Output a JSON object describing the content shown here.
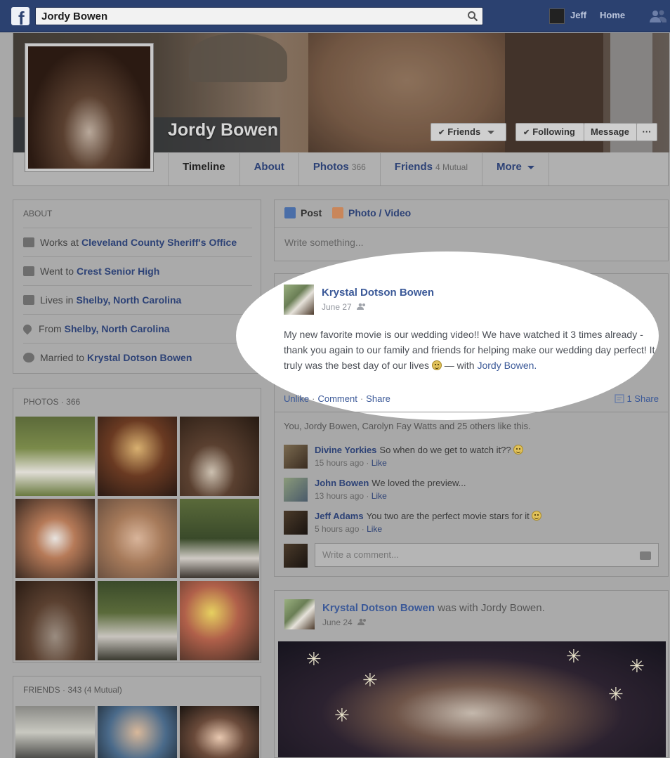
{
  "topbar": {
    "search_value": "Jordy Bowen",
    "user_name": "Jeff",
    "home_label": "Home"
  },
  "profile": {
    "name": "Jordy Bowen",
    "buttons": {
      "friends": "Friends",
      "following": "Following",
      "message": "Message",
      "more": "···"
    },
    "tabs": [
      {
        "label": "Timeline",
        "count": ""
      },
      {
        "label": "About",
        "count": ""
      },
      {
        "label": "Photos",
        "count": "366"
      },
      {
        "label": "Friends",
        "count": "4 Mutual"
      },
      {
        "label": "More",
        "count": ""
      }
    ]
  },
  "about": {
    "title": "ABOUT",
    "items": [
      {
        "prefix": "Works at",
        "link": "Cleveland County Sheriff's Office",
        "icon": "briefcase-icon"
      },
      {
        "prefix": "Went to",
        "link": "Crest Senior High",
        "icon": "school-icon"
      },
      {
        "prefix": "Lives in",
        "link": "Shelby, North Carolina",
        "icon": "home-icon"
      },
      {
        "prefix": "From",
        "link": "Shelby, North Carolina",
        "icon": "location-pin-icon"
      },
      {
        "prefix": "Married to",
        "link": "Krystal Dotson Bowen",
        "icon": "heart-icon"
      }
    ]
  },
  "photos_panel": {
    "title": "PHOTOS",
    "count": "366"
  },
  "friends_panel": {
    "title": "FRIENDS",
    "count": "343 (4 Mutual)"
  },
  "composer": {
    "post_label": "Post",
    "photo_label": "Photo / Video",
    "placeholder": "Write something..."
  },
  "post": {
    "author": "Krystal Dotson Bowen",
    "date": "June 27",
    "text": "My new favorite movie is our wedding video!! We have watched it 3 times already - thank you again to our family and friends for helping make our wedding day perfect! It truly was the best day of our lives",
    "with_prefix": "— with",
    "with_name": "Jordy Bowen.",
    "actions": {
      "unlike": "Unlike",
      "comment": "Comment",
      "share": "Share"
    },
    "share_count": "1 Share",
    "likes": "You, Jordy Bowen, Carolyn Fay Watts and 25 others like this.",
    "comments": [
      {
        "name": "Divine Yorkies",
        "text": "So when do we get to watch it??",
        "smiley": true,
        "time": "15 hours ago",
        "like": "Like"
      },
      {
        "name": "John Bowen",
        "text": "We loved the preview...",
        "smiley": false,
        "time": "13 hours ago",
        "like": "Like"
      },
      {
        "name": "Jeff Adams",
        "text": "You two are the perfect movie stars for it",
        "smiley": true,
        "time": "5 hours ago",
        "like": "Like"
      }
    ],
    "comment_placeholder": "Write a comment..."
  },
  "post2": {
    "author": "Krystal Dotson Bowen",
    "was_with": "was with Jordy Bowen.",
    "date": "June 24"
  }
}
